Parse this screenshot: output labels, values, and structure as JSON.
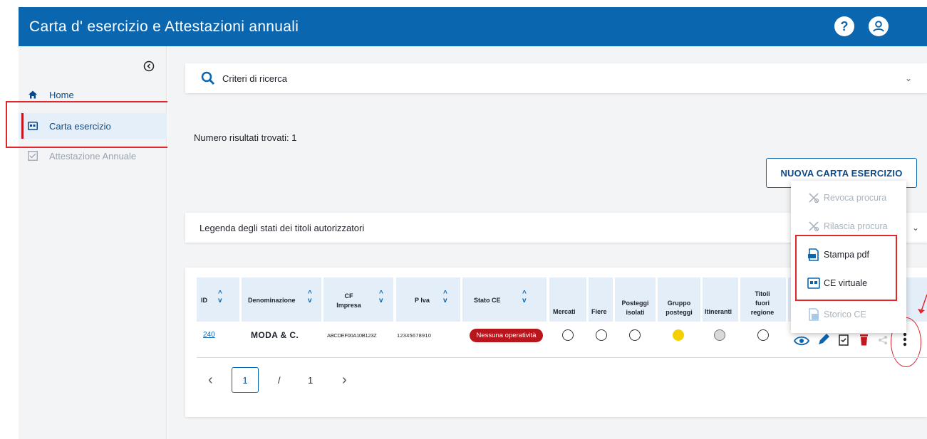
{
  "header": {
    "title": "Carta d' esercizio e Attestazioni annuali"
  },
  "sidebar": {
    "items": [
      {
        "label": "Home",
        "icon": "home-icon"
      },
      {
        "label": "Carta esercizio",
        "icon": "id-card-icon"
      },
      {
        "label": "Attestazione Annuale",
        "icon": "checklist-icon"
      }
    ]
  },
  "search": {
    "label": "Criteri di ricerca"
  },
  "results": {
    "text": "Numero risultati trovati: 1"
  },
  "new_button": {
    "label": "NUOVA CARTA ESERCIZIO"
  },
  "legend": {
    "label": "Legenda degli stati dei titoli autorizzatori"
  },
  "table": {
    "columns": [
      {
        "label": "ID",
        "sortable": true
      },
      {
        "label": "Denominazione",
        "sortable": true
      },
      {
        "label": "CF Impresa",
        "sortable": true
      },
      {
        "label": "P Iva",
        "sortable": true
      },
      {
        "label": "Stato CE",
        "sortable": true
      },
      {
        "label": "Mercati",
        "sortable": false
      },
      {
        "label": "Fiere",
        "sortable": false
      },
      {
        "label": "Posteggi isolati",
        "sortable": false
      },
      {
        "label": "Gruppo posteggi",
        "sortable": false
      },
      {
        "label": "Itineranti",
        "sortable": false
      },
      {
        "label": "Titoli fuori regione",
        "sortable": false
      }
    ],
    "rows": [
      {
        "id": "240",
        "denominazione": "MODA & C.",
        "cf_impresa": "ABCDEF00A10B123Z",
        "p_iva": "12345678910",
        "stato_ce": "Nessuna operatività"
      }
    ]
  },
  "pagination": {
    "current": "1",
    "separator": "/",
    "total": "1",
    "prev": "‹",
    "next": "›"
  },
  "context_menu": {
    "items": [
      {
        "label": "Revoca procura",
        "enabled": false
      },
      {
        "label": "Rilascia procura",
        "enabled": false
      },
      {
        "label": "Stampa pdf",
        "enabled": true
      },
      {
        "label": "CE virtuale",
        "enabled": true
      },
      {
        "label": "Storico CE",
        "enabled": false
      }
    ]
  },
  "colors": {
    "header": "#0b66b0",
    "badge": "#b8151c",
    "highlight": "#e2262b",
    "gruppo_posteggi": "#f5d000"
  }
}
